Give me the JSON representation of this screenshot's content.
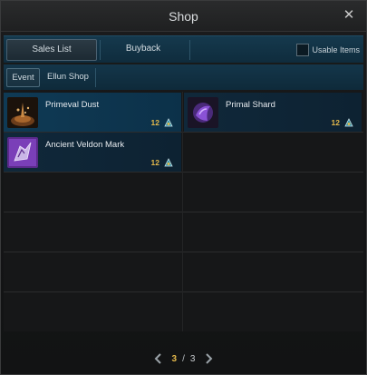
{
  "window": {
    "title": "Shop"
  },
  "tabs": [
    {
      "label": "Sales List",
      "active": true
    },
    {
      "label": "Buyback",
      "active": false
    }
  ],
  "usable_items": {
    "label": "Usable Items",
    "checked": false
  },
  "subtabs": [
    {
      "label": "Event",
      "active": true
    },
    {
      "label": "Ellun Shop",
      "active": false
    }
  ],
  "items": [
    {
      "name": "Primeval Dust",
      "price": "12",
      "icon": "dust-icon",
      "selected": true
    },
    {
      "name": "Primal Shard",
      "price": "12",
      "icon": "shard-icon",
      "selected": false
    },
    {
      "name": "Ancient Veldon Mark",
      "price": "12",
      "icon": "mark-icon",
      "selected": false
    }
  ],
  "pager": {
    "current": "3",
    "separator": "/",
    "total": "3"
  },
  "colors": {
    "accent": "#e4b94b",
    "selected_row": "#0f3a55",
    "tab_bar": "#15394d"
  }
}
